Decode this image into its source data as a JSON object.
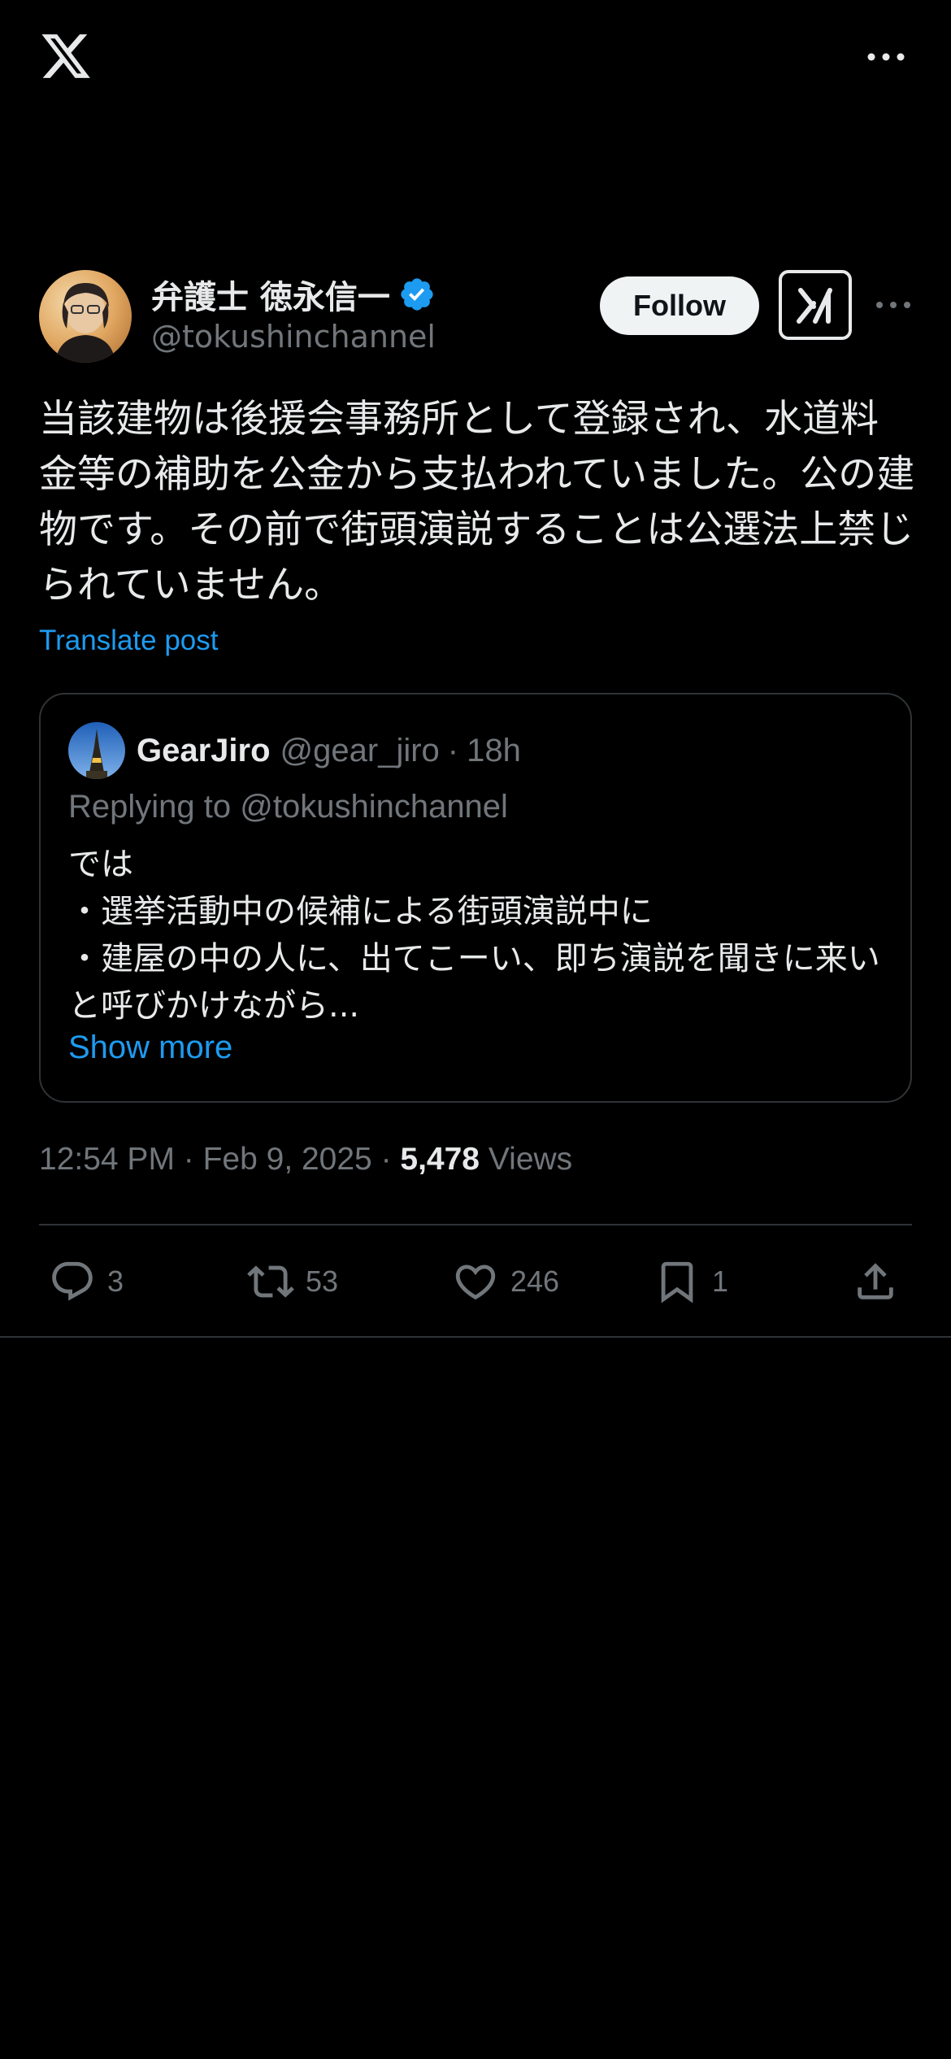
{
  "header": {
    "logo_icon": "x-logo-icon",
    "more_icon": "more-horizontal-icon"
  },
  "author": {
    "name": "弁護士 徳永信一",
    "handle": "@tokushinchannel",
    "verified": true,
    "follow_label": "Follow",
    "grok_icon": "grok-icon",
    "more_icon": "more-horizontal-icon"
  },
  "tweet": {
    "text": "当該建物は後援会事務所として登録され、水道料金等の補助を公金から支払われていました。公の建物です。その前で街頭演説することは公選法上禁じられていません。",
    "translate_label": "Translate post"
  },
  "quote": {
    "name": "GearJiro",
    "handle": "@gear_jiro",
    "separator": "·",
    "time": "18h",
    "replying_to": "Replying to @tokushinchannel",
    "text": "では\n・選挙活動中の候補による街頭演説中に\n・建屋の中の人に、出てこーい、即ち演説を聞きに来いと呼びかけながら...",
    "show_more": "Show more"
  },
  "meta": {
    "time": "12:54 PM · Feb 9, 2025 · ",
    "views_count": "5,478",
    "views_label": " Views"
  },
  "actions": {
    "reply_count": "3",
    "repost_count": "53",
    "like_count": "246",
    "bookmark_count": "1"
  },
  "colors": {
    "background": "#000000",
    "text": "#e7e9ea",
    "muted": "#71767b",
    "accent": "#1d9bf0",
    "border": "#2f3336"
  }
}
